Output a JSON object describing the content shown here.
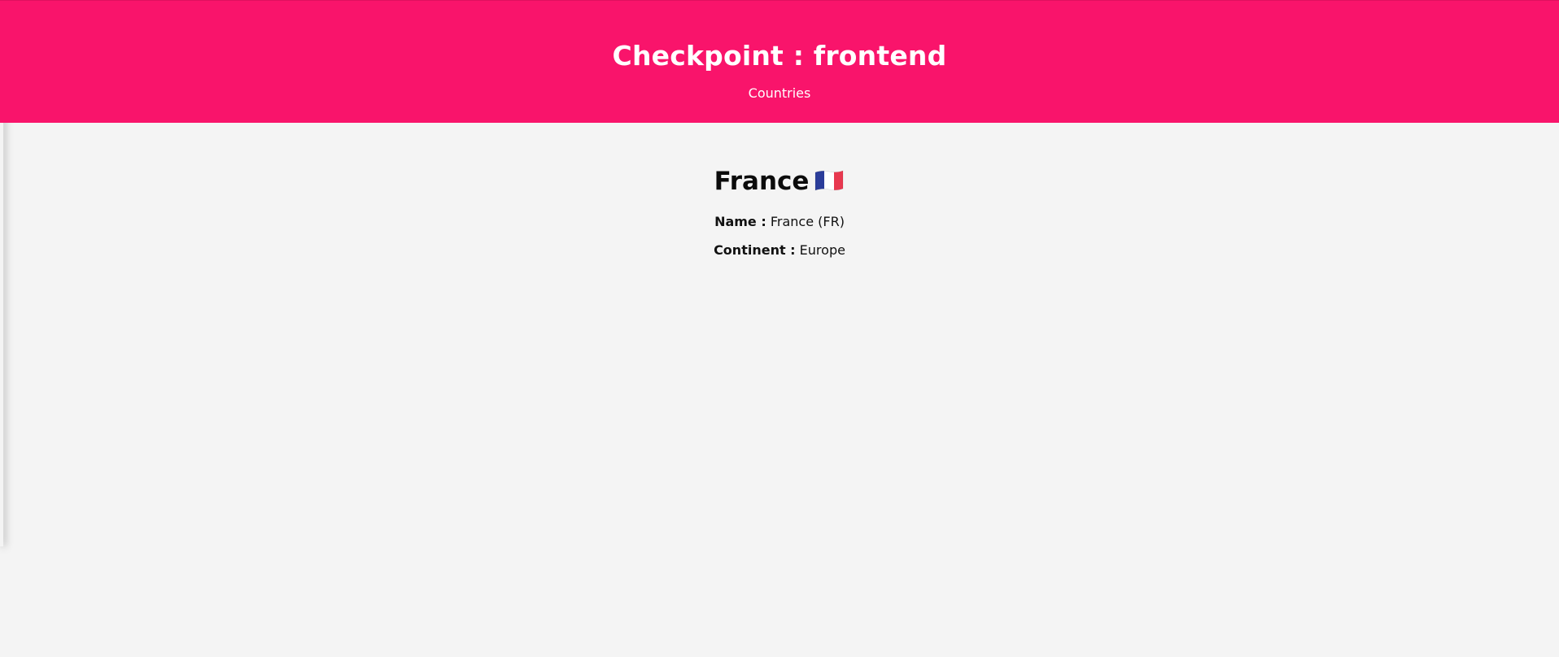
{
  "header": {
    "title": "Checkpoint : frontend",
    "nav_link": "Countries"
  },
  "country": {
    "name_heading": "France",
    "flag_icon": "france-flag-icon",
    "name_label": "Name :",
    "name_value": "France (FR)",
    "continent_label": "Continent :",
    "continent_value": "Europe"
  },
  "colors": {
    "header_background": "#f9146b",
    "page_background": "#f4f4f4",
    "flag_blue": "#2b3d9a",
    "flag_white": "#ffffff",
    "flag_red": "#e8384f"
  }
}
